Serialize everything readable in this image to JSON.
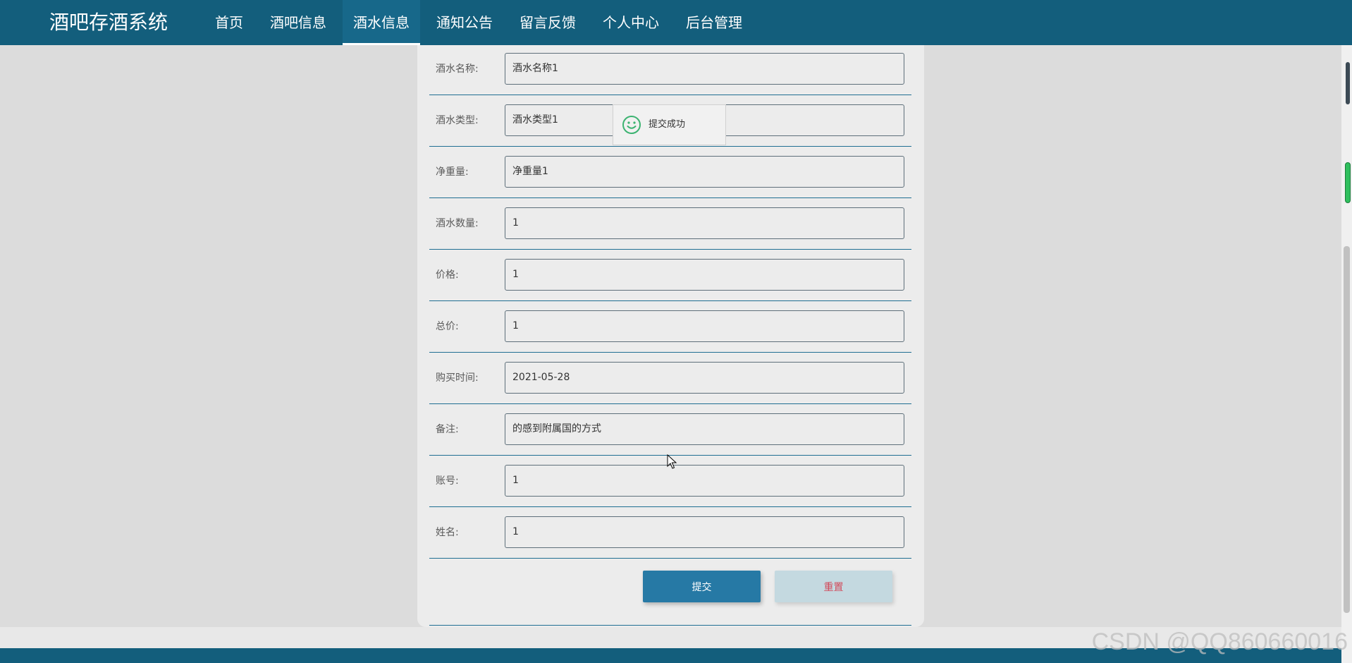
{
  "header": {
    "brand": "酒吧存酒系统",
    "nav": [
      {
        "label": "首页",
        "active": false
      },
      {
        "label": "酒吧信息",
        "active": false
      },
      {
        "label": "酒水信息",
        "active": true
      },
      {
        "label": "通知公告",
        "active": false
      },
      {
        "label": "留言反馈",
        "active": false
      },
      {
        "label": "个人中心",
        "active": false
      },
      {
        "label": "后台管理",
        "active": false
      }
    ]
  },
  "form": {
    "fields": [
      {
        "label": "酒水名称:",
        "value": "酒水名称1"
      },
      {
        "label": "酒水类型:",
        "value": "酒水类型1"
      },
      {
        "label": "净重量:",
        "value": "净重量1"
      },
      {
        "label": "酒水数量:",
        "value": "1"
      },
      {
        "label": "价格:",
        "value": "1"
      },
      {
        "label": "总价:",
        "value": "1"
      },
      {
        "label": "购买时间:",
        "value": "2021-05-28"
      },
      {
        "label": "备注:",
        "value": "的感到附属国的方式"
      },
      {
        "label": "账号:",
        "value": "1"
      },
      {
        "label": "姓名:",
        "value": "1"
      }
    ],
    "submit_label": "提交",
    "reset_label": "重置"
  },
  "toast": {
    "text": "提交成功",
    "icon": "smile-icon"
  },
  "watermark": "CSDN @QQ860660016",
  "colors": {
    "primary": "#135e7c",
    "accent": "#2679a5",
    "reset_text": "#d24a5a"
  }
}
